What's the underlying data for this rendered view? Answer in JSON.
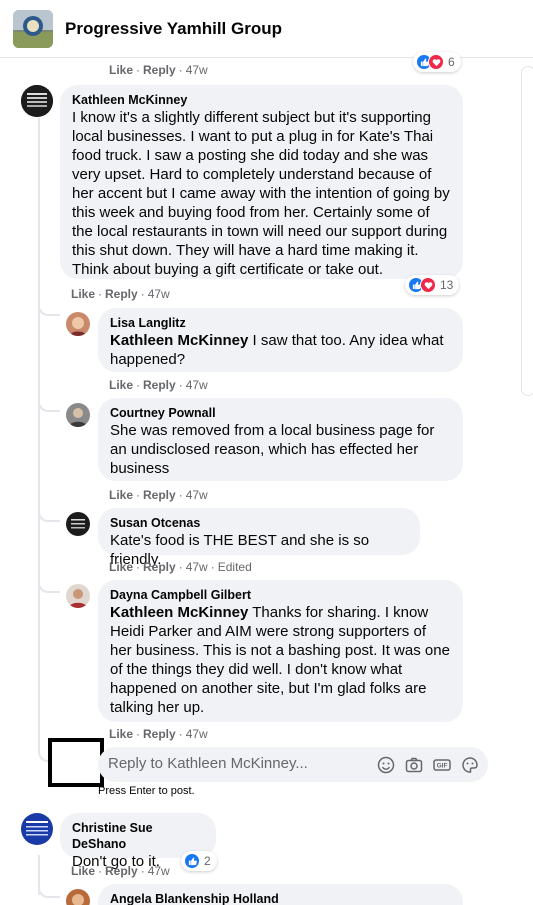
{
  "group": {
    "name": "Progressive Yamhill Group"
  },
  "colors": {
    "link": "#65676b",
    "like_blue": "#1877f2",
    "love_red": "#f02849",
    "bubble_bg": "#f0f2f5"
  },
  "top_actions": {
    "like": "Like",
    "reply": "Reply",
    "time": "47w",
    "react_count": "6"
  },
  "comments": [
    {
      "author": "Kathleen McKinney",
      "mention": "",
      "text": "I know it's a slightly different subject but it's supporting local businesses. I want to put a plug in for Kate's Thai food truck. I saw a posting she did today and she was very upset. Hard to completely understand because of her accent but I came away with the intention of going by this week and buying food from her. Certainly some of the local restaurants in town will need our support during this shut down. They will have a hard time making it. Think about buying a gift certificate or take out.",
      "like": "Like",
      "reply": "Reply",
      "time": "47w",
      "react_count": "13"
    },
    {
      "author": "Lisa Langlitz",
      "mention": "Kathleen McKinney",
      "text": " I saw that too. Any idea what happened?",
      "like": "Like",
      "reply": "Reply",
      "time": "47w"
    },
    {
      "author": "Courtney Pownall",
      "mention": "",
      "text": "She was removed from a local business page for an undisclosed reason, which has effected her business",
      "like": "Like",
      "reply": "Reply",
      "time": "47w"
    },
    {
      "author": "Susan Otcenas",
      "mention": "",
      "text": "Kate's food is THE BEST and she is so friendly.",
      "like": "Like",
      "reply": "Reply",
      "time": "47w",
      "edited": "Edited"
    },
    {
      "author": "Dayna Campbell Gilbert",
      "mention": "Kathleen McKinney",
      "text": " Thanks for sharing. I know Heidi Parker and AIM were strong supporters of her business. This is not a bashing post. It was one of the things they did well. I don't know what happened on another site, but I'm glad folks are talking her up.",
      "like": "Like",
      "reply": "Reply",
      "time": "47w"
    },
    {
      "author": "Christine Sue DeShano",
      "mention": "",
      "text": "Don't go to it.",
      "like": "Like",
      "reply": "Reply",
      "time": "47w",
      "react_count": "2"
    },
    {
      "author": "Angela Blankenship Holland",
      "mention": "",
      "text": ""
    }
  ],
  "reply_box": {
    "placeholder": "Reply to Kathleen McKinney...",
    "hint": "Press Enter to post."
  },
  "icons": [
    "emoji-icon",
    "camera-icon",
    "gif-icon",
    "sticker-icon"
  ]
}
